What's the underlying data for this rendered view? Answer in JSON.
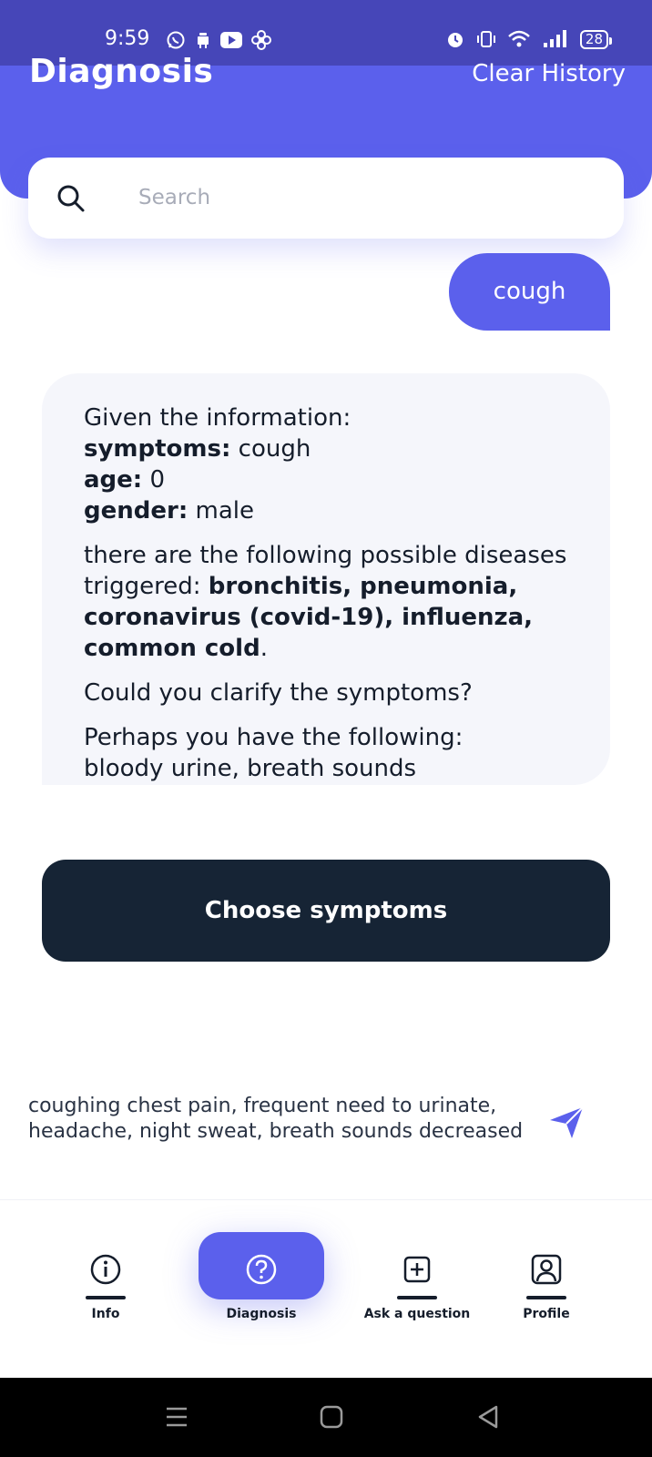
{
  "status_bar": {
    "time": "9:59",
    "battery": "28",
    "icons_left": [
      "whatsapp-icon",
      "android-icon",
      "youtube-icon",
      "fan-icon"
    ],
    "icons_right": [
      "alarm-icon",
      "vibrate-icon",
      "wifi-icon",
      "signal-icon",
      "battery-icon"
    ]
  },
  "header": {
    "title": "Diagnosis",
    "clear_history": "Clear History"
  },
  "search": {
    "placeholder": "Search"
  },
  "chat": {
    "user_message": "cough",
    "bot": {
      "intro": "Given the information:",
      "symptoms_label": "symptoms:",
      "symptoms_value": " cough",
      "age_label": "age:",
      "age_value": " 0",
      "gender_label": "gender:",
      "gender_value": " male",
      "diseases_prefix": "there are the following possible diseases triggered: ",
      "diseases_bold": "bronchitis, pneumonia, coronavirus (covid-19), influenza, common cold",
      "diseases_suffix": ".",
      "clarify": "Could you clarify the symptoms?",
      "perhaps": "Perhaps you have the following:",
      "cut_off_line": "bloody urine, breath sounds"
    }
  },
  "choose_symptoms_button": "Choose symptoms",
  "input": {
    "value": "coughing chest pain, frequent need to urinate, headache, night sweat, breath sounds decreased"
  },
  "bottom_nav": {
    "items": [
      {
        "label": "Info",
        "icon": "info-icon"
      },
      {
        "label": "Diagnosis",
        "icon": "question-icon",
        "active": true
      },
      {
        "label": "Ask a question",
        "icon": "plus-square-icon"
      },
      {
        "label": "Profile",
        "icon": "profile-icon"
      }
    ]
  },
  "colors": {
    "accent": "#5b60ec",
    "status_bar": "#4646b8",
    "dark_button": "#162435",
    "bubble_bg": "#f5f6fb"
  }
}
